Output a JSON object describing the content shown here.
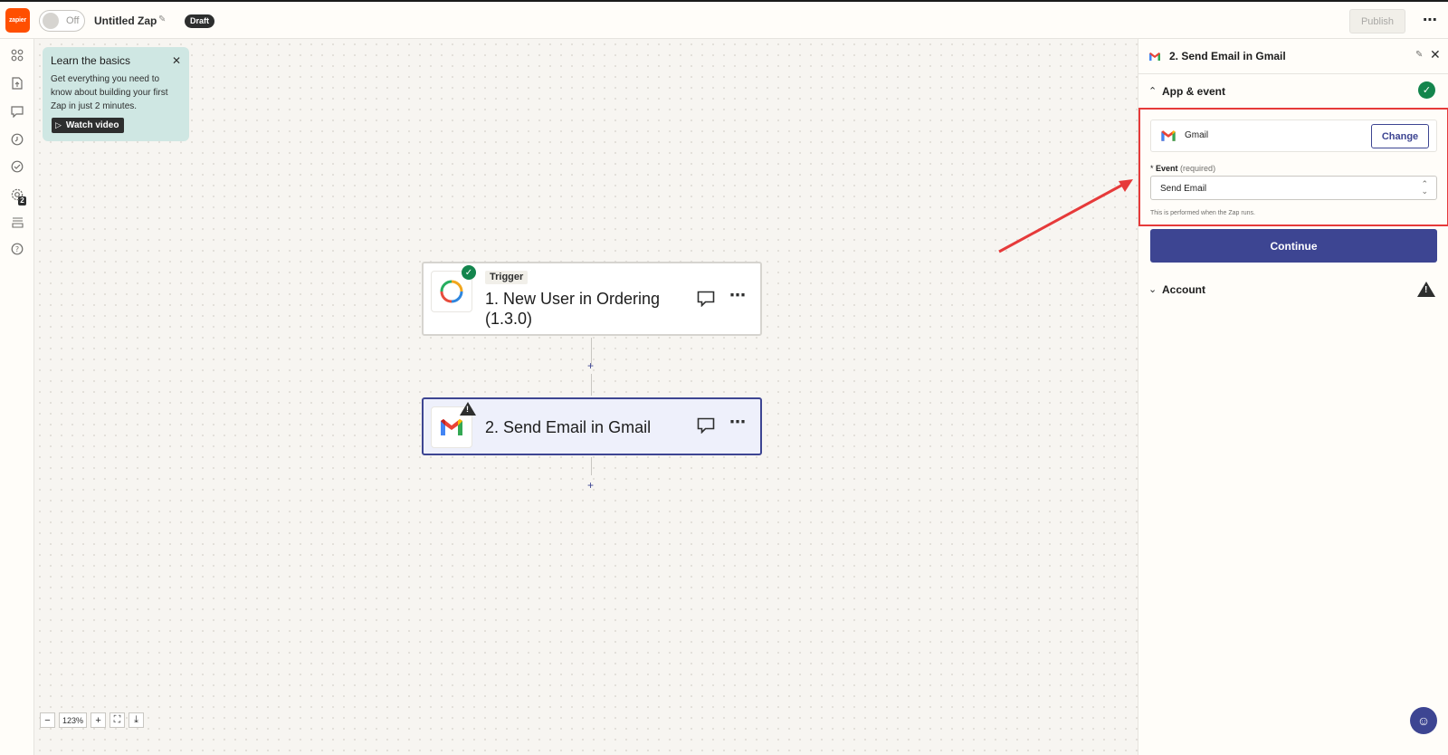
{
  "topbar": {
    "logo_text": "zapier",
    "toggle_label": "Off",
    "zap_name": "Untitled Zap",
    "status_badge": "Draft",
    "publish_label": "Publish"
  },
  "rail": {
    "icons": [
      "apps-icon",
      "upload-icon",
      "comment-icon",
      "history-icon",
      "status-icon",
      "settings-icon",
      "versions-icon",
      "help-icon"
    ],
    "status_count": "2"
  },
  "learn_card": {
    "title": "Learn the basics",
    "body": "Get everything you need to know about building your first Zap in just 2 minutes.",
    "watch_label": "Watch video"
  },
  "steps": [
    {
      "tag": "Trigger",
      "title": "1. New User in Ordering (1.3.0)",
      "status": "ok"
    },
    {
      "tag": "",
      "title": "2. Send Email in Gmail",
      "status": "warning"
    }
  ],
  "zoom": {
    "level": "123%"
  },
  "panel": {
    "title": "2. Send Email in Gmail",
    "app_event_section": "App & event",
    "app_name": "Gmail",
    "change_label": "Change",
    "event_label": "Event",
    "event_required": "(required)",
    "event_value": "Send Email",
    "event_help": "This is performed when the Zap runs.",
    "continue_label": "Continue",
    "account_section": "Account"
  },
  "colors": {
    "accent": "#3d4592",
    "brand": "#ff4f00",
    "success": "#13854d",
    "annotation": "#e63a3a"
  }
}
